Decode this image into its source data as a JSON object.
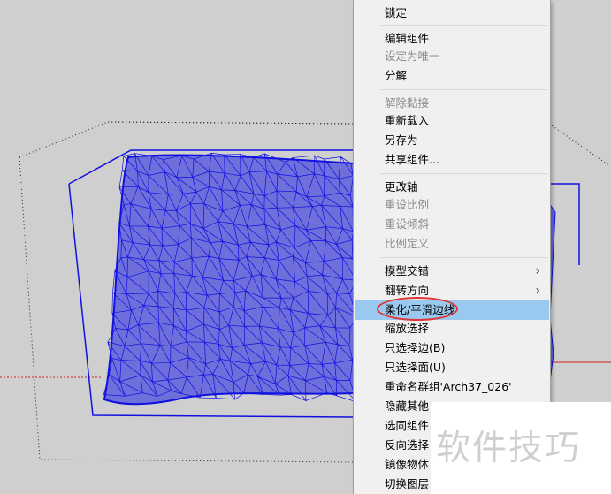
{
  "context_menu": {
    "items": [
      {
        "label": "锁定",
        "disabled": false,
        "submenu": false,
        "highlighted": false
      },
      {
        "separator": true
      },
      {
        "label": "编辑组件",
        "disabled": false,
        "submenu": false,
        "highlighted": false
      },
      {
        "label": "设定为唯一",
        "disabled": true,
        "submenu": false,
        "highlighted": false
      },
      {
        "label": "分解",
        "disabled": false,
        "submenu": false,
        "highlighted": false
      },
      {
        "separator": true
      },
      {
        "label": "解除黏接",
        "disabled": true,
        "submenu": false,
        "highlighted": false
      },
      {
        "label": "重新载入",
        "disabled": false,
        "submenu": false,
        "highlighted": false
      },
      {
        "label": "另存为",
        "disabled": false,
        "submenu": false,
        "highlighted": false
      },
      {
        "label": "共享组件...",
        "disabled": false,
        "submenu": false,
        "highlighted": false
      },
      {
        "separator": true
      },
      {
        "label": "更改轴",
        "disabled": false,
        "submenu": false,
        "highlighted": false
      },
      {
        "label": "重设比例",
        "disabled": true,
        "submenu": false,
        "highlighted": false
      },
      {
        "label": "重设倾斜",
        "disabled": true,
        "submenu": false,
        "highlighted": false
      },
      {
        "label": "比例定义",
        "disabled": true,
        "submenu": false,
        "highlighted": false
      },
      {
        "separator": true
      },
      {
        "label": "模型交错",
        "disabled": false,
        "submenu": true,
        "highlighted": false
      },
      {
        "label": "翻转方向",
        "disabled": false,
        "submenu": true,
        "highlighted": false
      },
      {
        "label": "柔化/平滑边线",
        "disabled": false,
        "submenu": false,
        "highlighted": true
      },
      {
        "label": "缩放选择",
        "disabled": false,
        "submenu": false,
        "highlighted": false
      },
      {
        "label": "只选择边(B)",
        "disabled": false,
        "submenu": false,
        "highlighted": false
      },
      {
        "label": "只选择面(U)",
        "disabled": false,
        "submenu": false,
        "highlighted": false
      },
      {
        "label": "重命名群组'Arch37_026'",
        "disabled": false,
        "submenu": false,
        "highlighted": false
      },
      {
        "label": "隐藏其他",
        "disabled": false,
        "submenu": false,
        "highlighted": false
      },
      {
        "label": "选同组件",
        "disabled": false,
        "submenu": false,
        "highlighted": false
      },
      {
        "label": "反向选择",
        "disabled": false,
        "submenu": false,
        "highlighted": false
      },
      {
        "label": "镜像物体",
        "disabled": false,
        "submenu": false,
        "highlighted": false
      },
      {
        "label": "切换图层",
        "disabled": false,
        "submenu": false,
        "highlighted": false
      }
    ],
    "submenu_arrow": "›"
  },
  "watermark": {
    "text": "软件技巧"
  },
  "colors": {
    "mesh": "#1010e0",
    "highlight": "#99c9ef",
    "annotation_circle": "#e03535",
    "axis_red": "#cc2222"
  },
  "icons": {
    "submenu": "chevron-right-icon"
  }
}
